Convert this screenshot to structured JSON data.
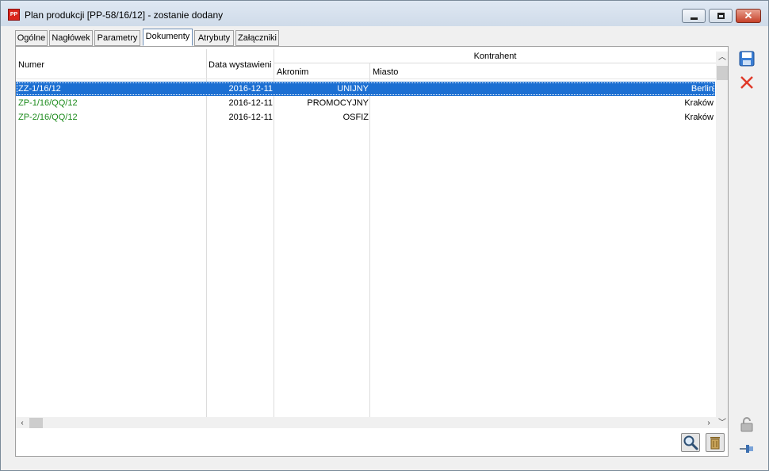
{
  "window": {
    "title": "Plan produkcji [PP-58/16/12] - zostanie dodany",
    "app_icon_text": "PP"
  },
  "tabs": [
    {
      "label": "Ogólne",
      "active": false
    },
    {
      "label": "Nagłówek",
      "active": false
    },
    {
      "label": "Parametry",
      "active": false
    },
    {
      "label": "Dokumenty",
      "active": true
    },
    {
      "label": "Atrybuty",
      "active": false
    },
    {
      "label": "Załączniki",
      "active": false
    }
  ],
  "grid": {
    "headers": {
      "numer": "Numer",
      "data": "Data wystawieni",
      "kontrahent": "Kontrahent",
      "akronim": "Akronim",
      "miasto": "Miasto"
    },
    "rows": [
      {
        "numer": "ZZ-1/16/12",
        "data": "2016-12-11",
        "akronim": "UNIJNY",
        "miasto": "Berlin",
        "selected": true
      },
      {
        "numer": "ZP-1/16/QQ/12",
        "data": "2016-12-11",
        "akronim": "PROMOCYJNY",
        "miasto": "Kraków",
        "selected": false
      },
      {
        "numer": "ZP-2/16/QQ/12",
        "data": "2016-12-11",
        "akronim": "OSFIZ",
        "miasto": "Kraków",
        "selected": false
      }
    ]
  },
  "icons": {
    "save": "save-icon",
    "delete": "delete-icon",
    "search": "search-icon",
    "trash": "trash-icon",
    "lock": "lock-icon",
    "pin": "pin-icon"
  },
  "colors": {
    "selection": "#1c6fd2",
    "number_text": "#1a8a1a"
  }
}
